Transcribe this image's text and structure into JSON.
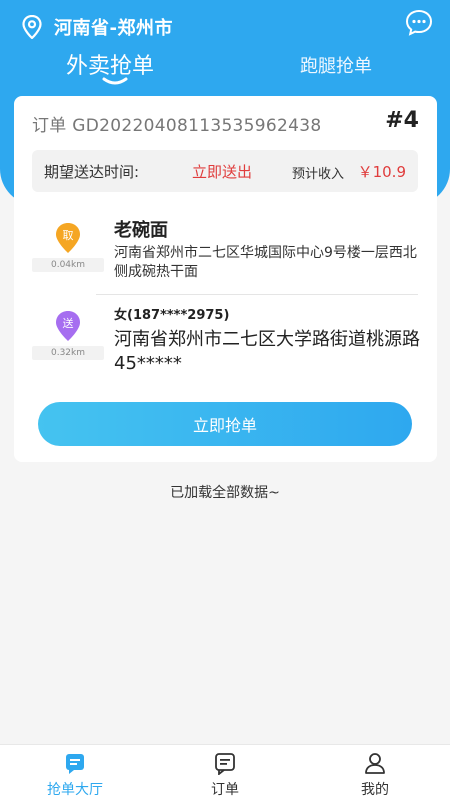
{
  "header": {
    "location": "河南省-郑州市",
    "tabs": [
      {
        "label": "外卖抢单",
        "active": true
      },
      {
        "label": "跑腿抢单",
        "active": false
      }
    ]
  },
  "order": {
    "id_label": "订单 GD20220408113535962438",
    "number": "#4",
    "eta_label": "期望送达时间:",
    "eta_value": "立即送出",
    "income_label": "预计收入",
    "income_value": "￥10.9",
    "pickup": {
      "badge": "取",
      "distance": "0.04km",
      "name": "老碗面",
      "address": "河南省郑州市二七区华城国际中心9号楼一层西北侧成碗热干面"
    },
    "delivery": {
      "badge": "送",
      "distance": "0.32km",
      "contact": "女(187****2975)",
      "address": "河南省郑州市二七区大学路街道桃源路45*****"
    },
    "grab_button": "立即抢单"
  },
  "list_status": "已加载全部数据~",
  "tabbar": [
    {
      "label": "抢单大厅",
      "icon": "hall-icon",
      "active": true
    },
    {
      "label": "订单",
      "icon": "order-icon",
      "active": false
    },
    {
      "label": "我的",
      "icon": "user-icon",
      "active": false
    }
  ],
  "colors": {
    "primary": "#2ea8ef",
    "price": "#e03c3c",
    "pickup_pin": "#f5a623",
    "delivery_pin": "#a66ef0"
  }
}
